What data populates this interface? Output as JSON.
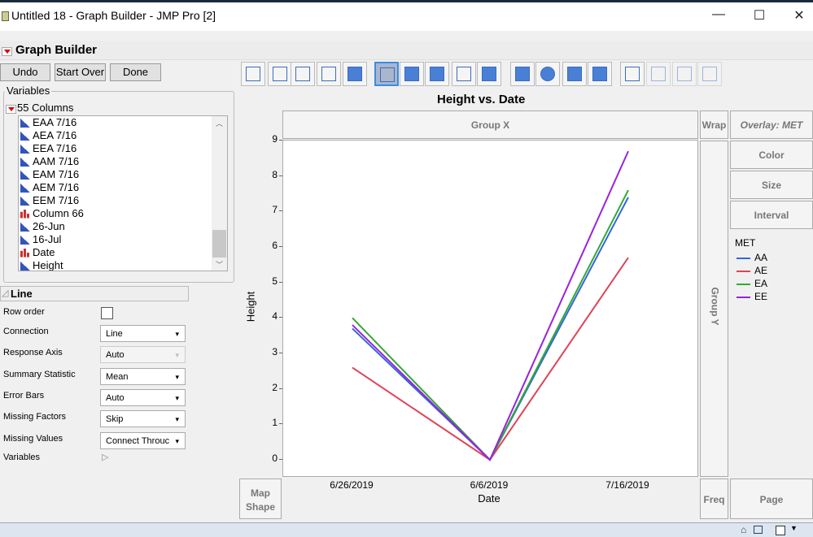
{
  "window": {
    "title": "Untitled 18 - Graph Builder - JMP Pro [2]",
    "minimize": "—",
    "maximize": "☐",
    "close": "✕"
  },
  "header": {
    "title": "Graph Builder"
  },
  "buttons": {
    "undo": "Undo",
    "start_over": "Start Over",
    "done": "Done"
  },
  "variables": {
    "label": "Variables",
    "columns_label": "55 Columns",
    "items": [
      {
        "label": "EAA 7/16",
        "type": "continuous"
      },
      {
        "label": "AEA 7/16",
        "type": "continuous"
      },
      {
        "label": "EEA 7/16",
        "type": "continuous"
      },
      {
        "label": "AAM 7/16",
        "type": "continuous"
      },
      {
        "label": "EAM 7/16",
        "type": "continuous"
      },
      {
        "label": "AEM 7/16",
        "type": "continuous"
      },
      {
        "label": "EEM 7/16",
        "type": "continuous"
      },
      {
        "label": "Column 66",
        "type": "nominal"
      },
      {
        "label": "26-Jun",
        "type": "continuous"
      },
      {
        "label": "16-Jul",
        "type": "continuous"
      },
      {
        "label": "Date",
        "type": "nominal"
      },
      {
        "label": "Height",
        "type": "continuous"
      }
    ]
  },
  "line_panel": {
    "title": "Line",
    "row_order": "Row order",
    "variables": "Variables",
    "options": [
      {
        "label": "Connection",
        "value": "Line"
      },
      {
        "label": "Response Axis",
        "value": "Auto",
        "disabled": true
      },
      {
        "label": "Summary Statistic",
        "value": "Mean"
      },
      {
        "label": "Error Bars",
        "value": "Auto"
      },
      {
        "label": "Missing Factors",
        "value": "Skip"
      },
      {
        "label": "Missing Values",
        "value": "Connect Throuc"
      }
    ]
  },
  "toolbar": {
    "icons": [
      "points",
      "smoother",
      "line-of-fit",
      "ellipse",
      "contour",
      "line",
      "bar",
      "area",
      "box-plot",
      "histogram",
      "heatmap",
      "pie",
      "treemap",
      "mosaic",
      "caption-box",
      "formula",
      "map-shapes",
      "parallel"
    ],
    "selected": "line"
  },
  "zones": {
    "group_x": "Group X",
    "group_y": "Group Y",
    "wrap": "Wrap",
    "overlay": "Overlay: MET",
    "color": "Color",
    "size": "Size",
    "interval": "Interval",
    "map_shape": "Map Shape",
    "freq": "Freq",
    "page": "Page"
  },
  "chart_data": {
    "type": "line",
    "title": "Height vs. Date",
    "xlabel": "Date",
    "ylabel": "Height",
    "categories": [
      "6/26/2019",
      "6/6/2019",
      "7/16/2019"
    ],
    "ylim": [
      0,
      9
    ],
    "yticks": [
      "0",
      "1",
      "2",
      "3",
      "4",
      "5",
      "6",
      "7",
      "8",
      "9"
    ],
    "legend_title": "MET",
    "legend_position": "right",
    "series": [
      {
        "name": "AA",
        "color": "#3366dd",
        "values": [
          3.7,
          0,
          7.4
        ]
      },
      {
        "name": "AE",
        "color": "#dd4455",
        "values": [
          2.6,
          0,
          5.7
        ]
      },
      {
        "name": "EA",
        "color": "#33aa33",
        "values": [
          4.0,
          0,
          7.6
        ]
      },
      {
        "name": "EE",
        "color": "#9922dd",
        "values": [
          3.8,
          0,
          8.7
        ]
      }
    ]
  }
}
